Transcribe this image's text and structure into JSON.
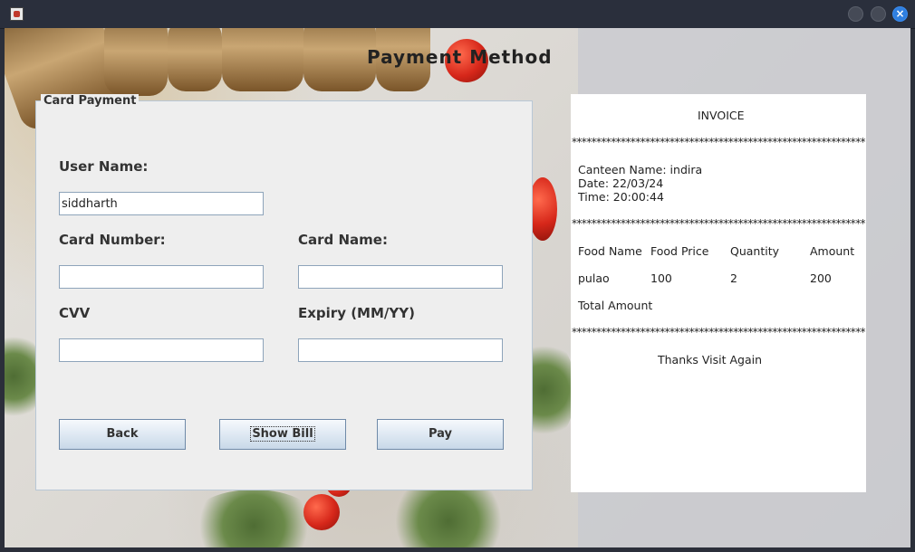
{
  "window": {
    "close_glyph": "×"
  },
  "page_title": "Payment Method",
  "card_payment": {
    "legend": "Card Payment",
    "user_name_label": "User Name:",
    "user_name_value": "siddharth",
    "card_number_label": "Card Number:",
    "card_number_value": "",
    "card_name_label": "Card Name:",
    "card_name_value": "",
    "cvv_label": "CVV",
    "cvv_value": "",
    "expiry_label": "Expiry (MM/YY)",
    "expiry_value": "",
    "buttons": {
      "back": "Back",
      "show_bill": "Show Bill",
      "pay": "Pay"
    }
  },
  "invoice": {
    "heading": "INVOICE",
    "separator": "************************************************************",
    "canteen_line": "Canteen Name: indira",
    "date_line": "Date: 22/03/24",
    "time_line": "Time: 20:00:44",
    "columns": [
      "Food Name",
      "Food Price",
      "Quantity",
      "Amount"
    ],
    "rows": [
      [
        "pulao",
        "100",
        "2",
        "200"
      ]
    ],
    "total_label": "Total Amount",
    "footer": "Thanks Visit Again"
  },
  "colors": {
    "close_button": "#2f7fe0",
    "panel_bg": "#eeeeee",
    "field_border": "#8ea4ba"
  }
}
